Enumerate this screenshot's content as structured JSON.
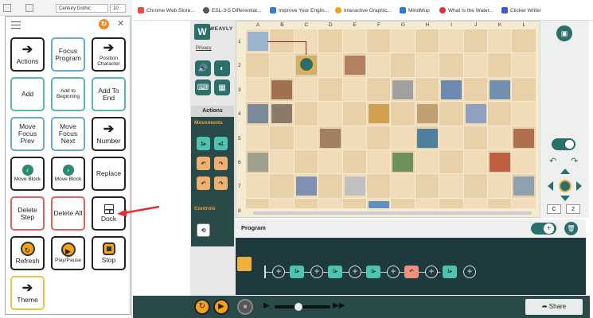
{
  "office": {
    "font_name": "Century Gothic",
    "font_size": "10"
  },
  "grid_buttons": [
    {
      "label": "Actions",
      "sym": "➔"
    },
    {
      "label": "Focus Program"
    },
    {
      "label": "Position Character",
      "sym": "➔"
    },
    {
      "label": "Add"
    },
    {
      "label": "Add to Beginning"
    },
    {
      "label": "Add To End"
    },
    {
      "label": "Move Focus Prev"
    },
    {
      "label": "Move Focus Next"
    },
    {
      "label": "Number",
      "sym": "➔"
    },
    {
      "label": "Move Block"
    },
    {
      "label": "Move Block"
    },
    {
      "label": "Replace"
    },
    {
      "label": "Delete Step"
    },
    {
      "label": "Delete All"
    },
    {
      "label": "Dock"
    },
    {
      "label": "Refresh"
    },
    {
      "label": "Play/Pause"
    },
    {
      "label": "Stop"
    },
    {
      "label": "Theme",
      "sym": "➔"
    }
  ],
  "tabs": [
    "Chrome Web Store...",
    "ESL-3-5 Differentiat...",
    "Improve Your Englis...",
    "Interactive Graphic...",
    "MindMup",
    "What Is the Water...",
    "Clicker Writer"
  ],
  "app": {
    "logo_letter": "W",
    "logo_text": "WEAVLY",
    "privacy": "Privacy",
    "actions_tab": "Actions",
    "movements_label": "Movements",
    "controls_label": "Controls",
    "movement_blocks": [
      "1▸",
      "◂1",
      "↶",
      "↷",
      "↶",
      "↷"
    ],
    "columns": [
      "A",
      "B",
      "C",
      "D",
      "E",
      "F",
      "G",
      "H",
      "I",
      "J",
      "K",
      "L"
    ],
    "rows": [
      "1",
      "2",
      "3",
      "4",
      "5",
      "6",
      "7",
      "8"
    ],
    "program_title": "Program",
    "coord_col": "C",
    "coord_row": "2",
    "share_label": "Share",
    "program_blocks": [
      "1▸",
      "1▸",
      "1▸",
      "↶",
      "1▸"
    ]
  }
}
